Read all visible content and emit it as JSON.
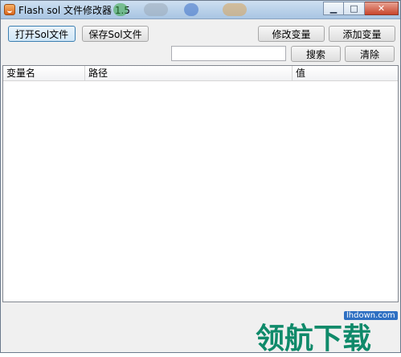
{
  "window": {
    "title": "Flash sol 文件修改器 1.5",
    "controls": {
      "minimize": "▁",
      "maximize": "□",
      "close": "✕"
    }
  },
  "toolbar": {
    "open_label": "打开Sol文件",
    "save_label": "保存Sol文件",
    "modify_label": "修改变量",
    "add_label": "添加变量",
    "search_label": "搜索",
    "clear_label": "清除"
  },
  "search": {
    "value": "",
    "placeholder": ""
  },
  "table": {
    "columns": [
      "变量名",
      "路径",
      "值"
    ],
    "rows": []
  },
  "watermark": {
    "url": "lhdown.com",
    "text": "领航下载"
  }
}
